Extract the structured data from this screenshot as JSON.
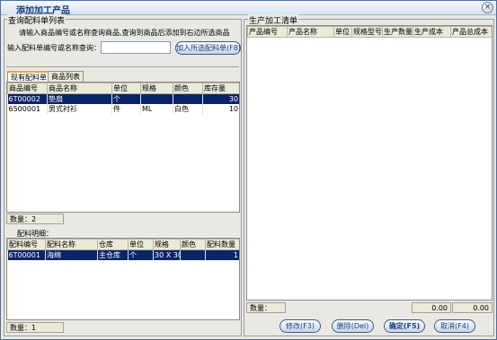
{
  "window": {
    "title": "添加加工产品",
    "close_glyph": "×"
  },
  "query": {
    "group_title": "查询配料单列表",
    "hint": "请输入商品编号或名称查询商品,查询到商品后添加到右边所选商品",
    "label": "输入配料单编号或名称查询：",
    "value": "",
    "add_button": "加入所选配料单(F8)"
  },
  "tabs": [
    {
      "label": "现有配料单"
    },
    {
      "label": "商品列表"
    }
  ],
  "goods_table": {
    "headers": [
      "商品编号",
      "商品名称",
      "单位",
      "规格",
      "颜色",
      "库存量"
    ],
    "rows": [
      {
        "code": "6T00002",
        "name": "垫扇",
        "unit": "个",
        "spec": "",
        "color": "",
        "stock": "30"
      },
      {
        "code": "6500001",
        "name": "男式衬衫",
        "unit": "件",
        "spec": "ML",
        "color": "白色",
        "stock": "10"
      }
    ],
    "count_text": "数量：2"
  },
  "detail": {
    "title": "配料明细：",
    "headers": [
      "配料编号",
      "配料名称",
      "仓库",
      "单位",
      "规格",
      "颜色",
      "配料数量"
    ],
    "rows": [
      {
        "code": "6T00001",
        "name": "海绵",
        "warehouse": "主仓库",
        "unit": "个",
        "spec": "30 X 30",
        "color": "",
        "qty": "1"
      }
    ],
    "count_text": "数量：1"
  },
  "production": {
    "title": "生产加工清单",
    "headers": [
      "产品编号",
      "产品名称",
      "单位",
      "规格型号",
      "生产数量",
      "生产成本",
      "产品总成本"
    ],
    "count_text": "数量：",
    "total_cost": "0.00",
    "total_amount": "0.00"
  },
  "buttons": {
    "modify": "修改(F3)",
    "delete": "删除(Del)",
    "confirm": "确定(F5)",
    "cancel": "取消(F4)"
  }
}
